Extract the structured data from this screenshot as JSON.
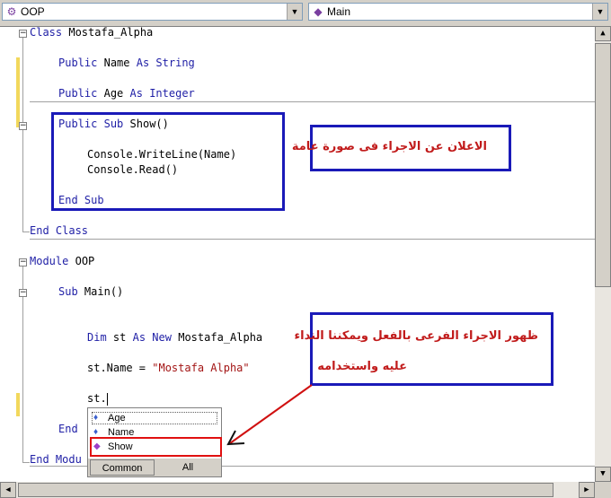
{
  "toolbar": {
    "class_combo": {
      "icon": "class-icon",
      "value": "OOP"
    },
    "member_combo": {
      "icon": "method-icon",
      "value": "Main"
    }
  },
  "code": {
    "class_kw": "Class",
    "class_name": "Mostafa_Alpha",
    "public1": "Public",
    "name_field": "Name",
    "as1": "As",
    "string_type": "String",
    "public2": "Public",
    "age_field": "Age",
    "as2": "As",
    "integer_type": "Integer",
    "public3": "Public",
    "sub1": "Sub",
    "show_sig": "Show()",
    "writeline": "Console.WriteLine(Name)",
    "read": "Console.Read()",
    "end_sub1": "End Sub",
    "end_class": "End Class",
    "module_kw": "Module",
    "module_name": "OOP",
    "sub2": "Sub",
    "main_sig": "Main()",
    "dim_kw": "Dim",
    "dim_var": "st",
    "as3": "As",
    "new_kw": "New",
    "dim_type": "Mostafa_Alpha",
    "assign_lhs": "st.Name = ",
    "assign_str": "\"Mostafa Alpha\"",
    "typing": "st.",
    "end_sub2": "End",
    "end_module": "End Modu"
  },
  "annotations": {
    "note1": "الاعلان عن الاجراء فى صورة عامة",
    "note2_line1": "ظهور الاجراء الفرعى بالفعل ويمكننا النداء",
    "note2_line2": "عليه واستخدامه"
  },
  "intellisense": {
    "items": [
      {
        "label": "Age",
        "icon": "property-icon"
      },
      {
        "label": "Name",
        "icon": "property-icon"
      },
      {
        "label": "Show",
        "icon": "method-icon"
      }
    ],
    "tabs": {
      "common": "Common",
      "all": "All"
    }
  },
  "colors": {
    "keyword": "#1f1fa6",
    "string": "#a31515",
    "annotation_text": "#c11b1b",
    "annotation_border": "#1a1ab8",
    "highlight": "#e01010"
  }
}
